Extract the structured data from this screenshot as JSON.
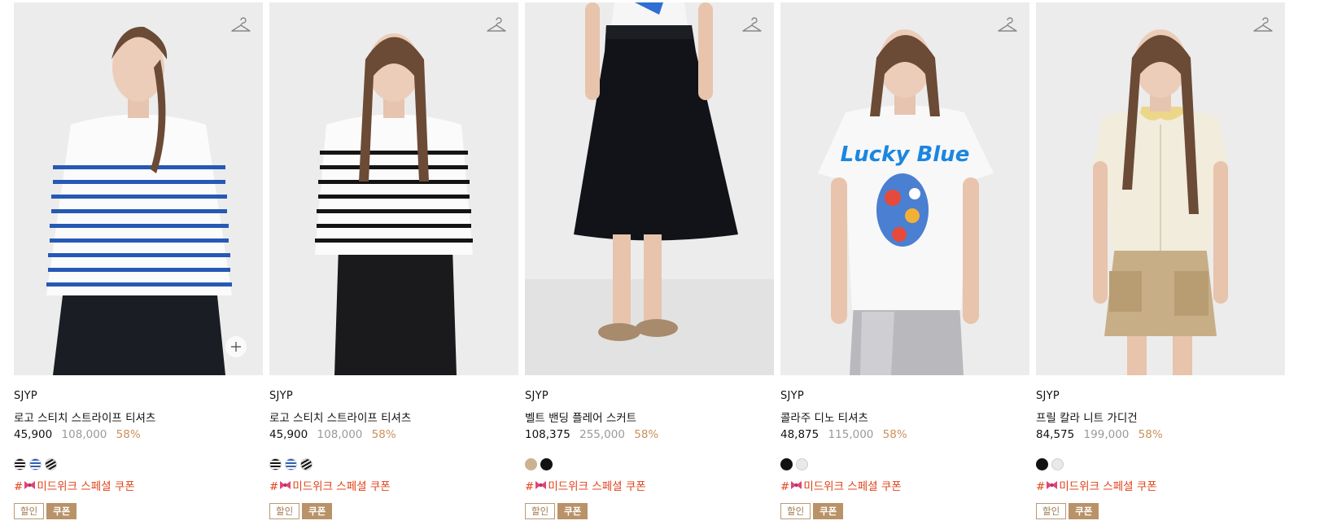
{
  "products": [
    {
      "brand": "SJYP",
      "name": "로고 스티치 스트라이프 티셔츠",
      "price_sale": "45,900",
      "price_original": "108,000",
      "discount_rate": "58%",
      "swatches": [
        "stripe-black",
        "stripe-blue",
        "stripe-navy"
      ],
      "coupon_prefix": "#",
      "coupon_text": "미드위크 스페셜 쿠폰",
      "badges": [
        "할인",
        "쿠폰"
      ],
      "has_add_button": true
    },
    {
      "brand": "SJYP",
      "name": "로고 스티치 스트라이프 티셔츠",
      "price_sale": "45,900",
      "price_original": "108,000",
      "discount_rate": "58%",
      "swatches": [
        "stripe-black",
        "stripe-blue",
        "stripe-navy"
      ],
      "coupon_prefix": "#",
      "coupon_text": "미드위크 스페셜 쿠폰",
      "badges": [
        "할인",
        "쿠폰"
      ],
      "has_add_button": false
    },
    {
      "brand": "SJYP",
      "name": "벨트 밴딩 플레어 스커트",
      "price_sale": "108,375",
      "price_original": "255,000",
      "discount_rate": "58%",
      "swatches": [
        "beige",
        "black"
      ],
      "coupon_prefix": "#",
      "coupon_text": "미드위크 스페셜 쿠폰",
      "badges": [
        "할인",
        "쿠폰"
      ],
      "has_add_button": false
    },
    {
      "brand": "SJYP",
      "name": "콜라주 디노 티셔츠",
      "price_sale": "48,875",
      "price_original": "115,000",
      "discount_rate": "58%",
      "swatches": [
        "black",
        "white"
      ],
      "coupon_prefix": "#",
      "coupon_text": "미드위크 스페셜 쿠폰",
      "badges": [
        "할인",
        "쿠폰"
      ],
      "has_add_button": false
    },
    {
      "brand": "SJYP",
      "name": "프릴 칼라 니트 가디건",
      "price_sale": "84,575",
      "price_original": "199,000",
      "discount_rate": "58%",
      "swatches": [
        "black",
        "white"
      ],
      "coupon_prefix": "#",
      "coupon_text": "미드위크 스페셜 쿠폰",
      "badges": [
        "할인",
        "쿠폰"
      ],
      "has_add_button": false
    }
  ],
  "icons": {
    "hanger": "hanger-icon",
    "plus": "plus-icon",
    "ribbon": "ribbon-emoji-icon"
  },
  "colors": {
    "discount": "#c9915c",
    "coupon_text": "#e0451b",
    "badge_accent": "#b99268"
  },
  "tshirt_print_text": "Lucky Blue"
}
